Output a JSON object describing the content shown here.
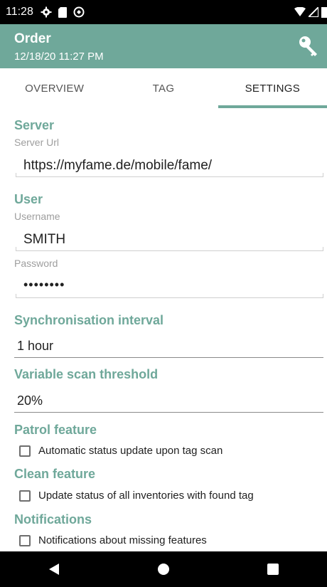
{
  "status_bar": {
    "time": "11:28",
    "icons": [
      "settings-gear-icon",
      "sd-card-icon",
      "sync-icon"
    ],
    "right_icons": [
      "wifi-icon",
      "signal-icon",
      "battery-icon"
    ]
  },
  "app_bar": {
    "title": "Order",
    "subtitle": "12/18/20 11:27 PM",
    "action_icon": "key-icon",
    "color": "#6fa89a"
  },
  "tabs": [
    {
      "label": "OVERVIEW",
      "active": false
    },
    {
      "label": "TAG",
      "active": false
    },
    {
      "label": "SETTINGS",
      "active": true
    }
  ],
  "settings": {
    "server": {
      "heading": "Server",
      "url_label": "Server Url",
      "url_value": "https://myfame.de/mobile/fame/"
    },
    "user": {
      "heading": "User",
      "username_label": "Username",
      "username_value": "SMITH",
      "password_label": "Password",
      "password_value": "••••••••"
    },
    "sync": {
      "heading": "Synchronisation interval",
      "value": "1 hour"
    },
    "threshold": {
      "heading": "Variable scan threshold",
      "value": "20%"
    },
    "patrol": {
      "heading": "Patrol feature",
      "checkbox_label": "Automatic status update upon tag scan",
      "checked": false
    },
    "clean": {
      "heading": "Clean feature",
      "checkbox_label": "Update status of all inventories with found tag",
      "checked": false
    },
    "notifications": {
      "heading": "Notifications",
      "checkbox_label": "Notifications about missing features",
      "checked": false
    }
  },
  "nav_bar": {
    "buttons": [
      "back-icon",
      "home-icon",
      "recents-icon"
    ]
  }
}
